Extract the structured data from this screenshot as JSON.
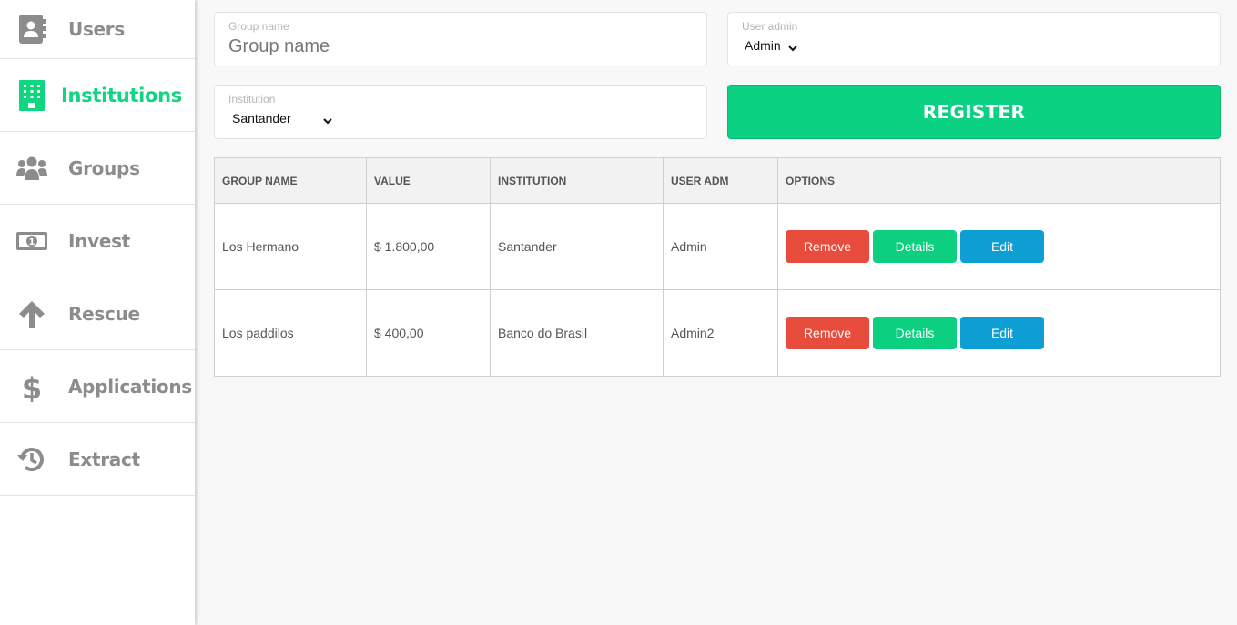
{
  "sidebar": {
    "items": [
      {
        "label": "Users",
        "icon": "contact-book-icon",
        "active": false
      },
      {
        "label": "Institutions",
        "icon": "building-icon",
        "active": true
      },
      {
        "label": "Groups",
        "icon": "users-group-icon",
        "active": false
      },
      {
        "label": "Invest",
        "icon": "money-bill-icon",
        "active": false
      },
      {
        "label": "Rescue",
        "icon": "arrow-up-icon",
        "active": false
      },
      {
        "label": "Applications",
        "icon": "dollar-sign-icon",
        "active": false
      },
      {
        "label": "Extract",
        "icon": "history-icon",
        "active": false
      }
    ],
    "active_color": "#10d682",
    "inactive_color": "#8c8c8c"
  },
  "form": {
    "group_name": {
      "label": "Group name",
      "placeholder": "Group name",
      "value": ""
    },
    "user_admin": {
      "label": "User admin",
      "selected": "Admin"
    },
    "institution": {
      "label": "Institution",
      "selected": "Santander"
    },
    "register_label": "REGISTER"
  },
  "table": {
    "headers": [
      "GROUP NAME",
      "VALUE",
      "INSTITUTION",
      "USER ADM",
      "OPTIONS"
    ],
    "rows": [
      {
        "group_name": "Los Hermano",
        "value": "$ 1.800,00",
        "institution": "Santander",
        "user_adm": "Admin"
      },
      {
        "group_name": "Los paddilos",
        "value": "$ 400,00",
        "institution": "Banco do Brasil",
        "user_adm": "Admin2"
      }
    ],
    "actions": {
      "remove": "Remove",
      "details": "Details",
      "edit": "Edit"
    }
  },
  "colors": {
    "register": "#0ad282",
    "remove": "#e74c3c",
    "details": "#0ccf7f",
    "edit": "#0d9fd4"
  }
}
